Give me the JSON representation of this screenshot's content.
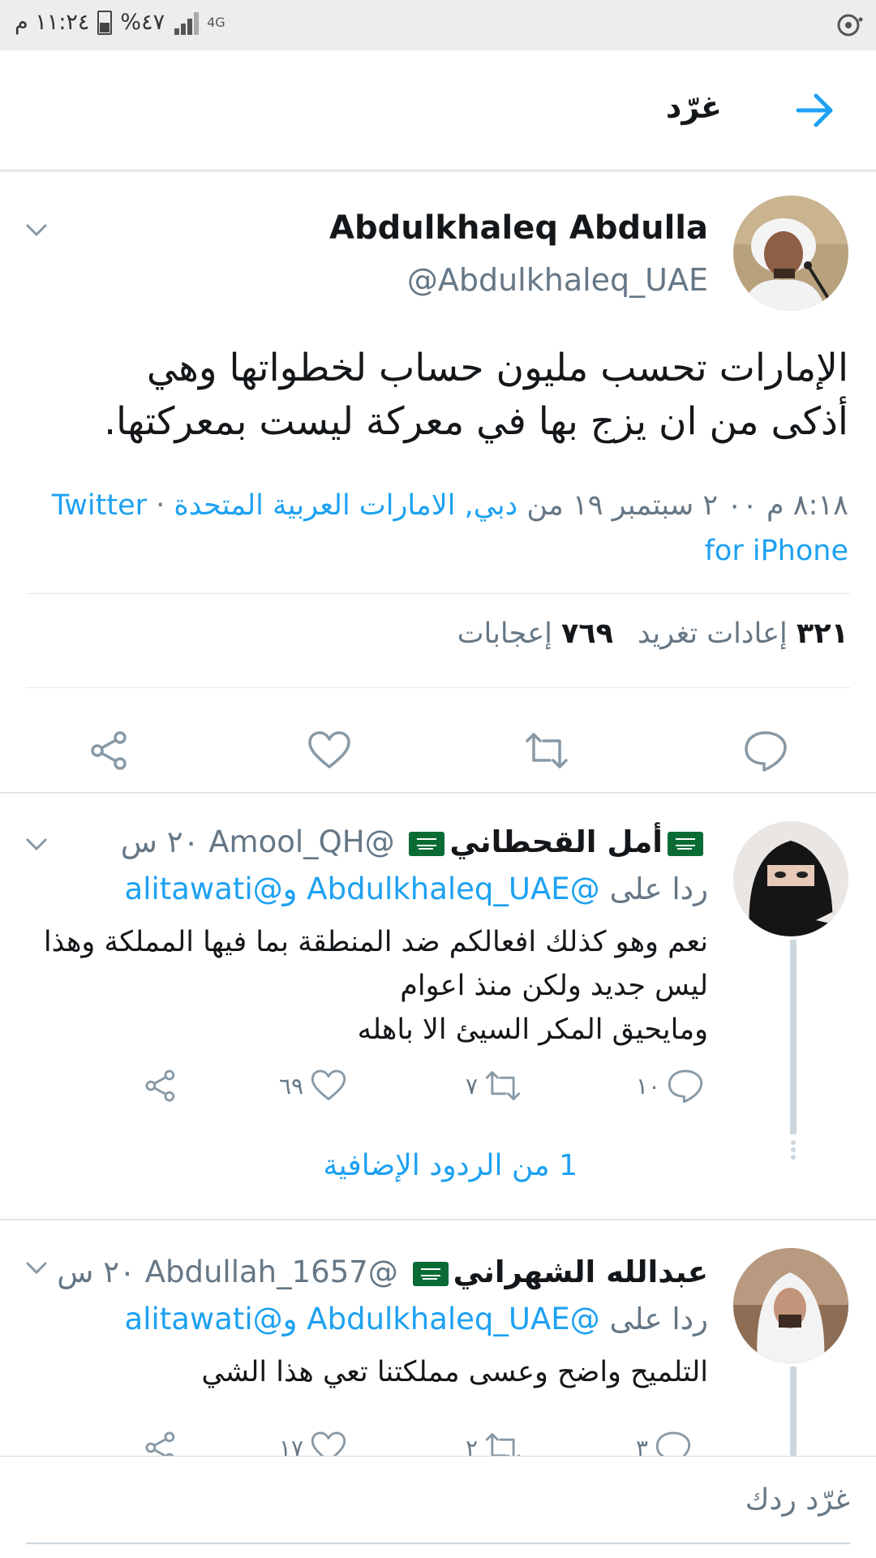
{
  "status_bar": {
    "time": "١١:٢٤ م",
    "battery": "%٤٧",
    "network": "4G"
  },
  "header": {
    "title": "غرّد"
  },
  "tweet": {
    "name": "Abdulkhaleq Abdulla",
    "handle": "@Abdulkhaleq_UAE",
    "text_line1": "الإمارات تحسب مليون حساب لخطواتها وهي",
    "text_line2": "أذكى من ان يزج بها في معركة ليست بمعركتها.",
    "time": "٨:١٨ م ٠٠ ٢ سبتمبر ١٩ من",
    "location": "دبي, الامارات العربية المتحدة",
    "source": "Twitter for iPhone",
    "retweets_count": "٣٢١",
    "retweets_label": "إعادات تغريد",
    "likes_count": "٧٦٩",
    "likes_label": "إعجابات"
  },
  "replies": [
    {
      "name": "أمل القحطاني",
      "handle": "@Amool_QH",
      "time": "٢٠ س",
      "reply_to_prefix": "ردا على",
      "reply_to_1": "@Abdulkhaleq_UAE",
      "reply_to_and": "و",
      "reply_to_2": "@alitawati",
      "text_lines": [
        "نعم وهو كذلك افعالكم ضد المنطقة بما فيها المملكة وهذا",
        "ليس جديد ولكن منذ اعوام",
        "ومايحيق المكر السيئ الا باهله"
      ],
      "reply_count": "١٠",
      "retweet_count": "٧",
      "like_count": "٦٩",
      "more_replies": "1 من الردود الإضافية"
    },
    {
      "name": "عبدالله الشهراني",
      "handle": "@Abdullah_1657",
      "time": "٢٠ س",
      "reply_to_prefix": "ردا على",
      "reply_to_1": "@Abdulkhaleq_UAE",
      "reply_to_and": "و",
      "reply_to_2": "@alitawati",
      "text_lines": [
        "التلميح واضح وعسى مملكتنا تعي هذا الشي"
      ],
      "reply_count": "٣",
      "retweet_count": "٢",
      "like_count": "١٧"
    }
  ],
  "compose": {
    "placeholder": "غرّد ردك"
  },
  "colors": {
    "accent": "#1da1f2",
    "secondary_text": "#657786",
    "primary_text": "#14171a",
    "flag_green": "#0b6b35"
  },
  "icons": [
    "back-arrow-icon",
    "chevron-down-icon",
    "reply-icon",
    "retweet-icon",
    "like-icon",
    "share-icon",
    "saudi-flag-icon",
    "battery-icon",
    "signal-icon"
  ]
}
